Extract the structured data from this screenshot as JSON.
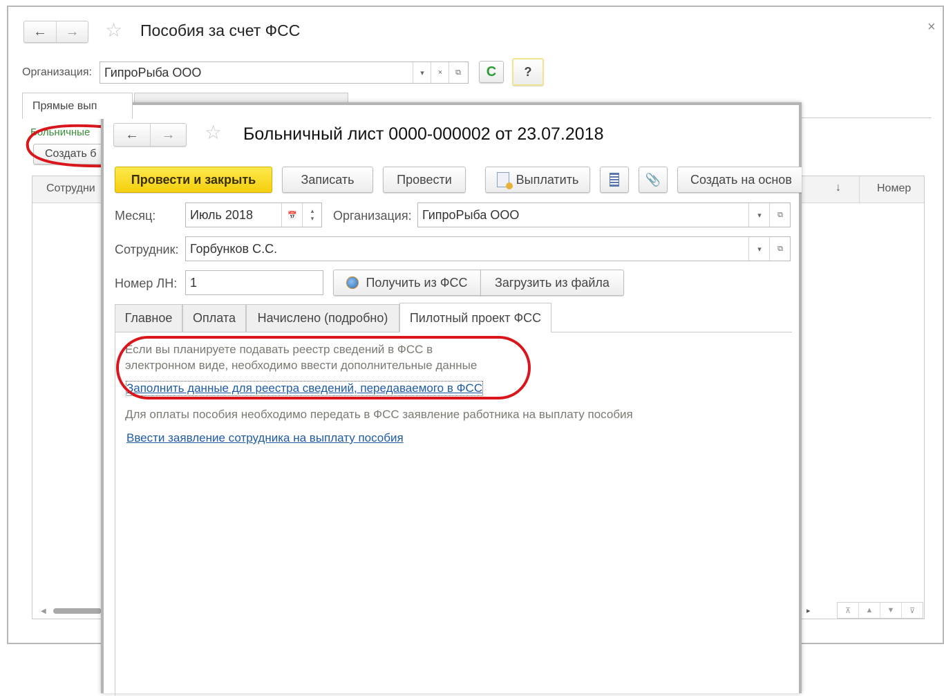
{
  "back_window": {
    "title": "Пособия за счет ФСС",
    "close_glyph": "×",
    "org_label": "Организация:",
    "org_value": "ГипроРыба ООО",
    "tab_direct_label": "Прямые вып",
    "section_link": "Больничные",
    "create_button": "Создать б",
    "col_employee": "Сотрудни",
    "col_sort_glyph": "↓",
    "col_number": "Номер",
    "help_button": "?",
    "refresh_glyph": "C"
  },
  "front_window": {
    "title": "Больничный лист 0000-000002 от 23.07.2018",
    "toolbar": {
      "post_close": "Провести и закрыть",
      "save": "Записать",
      "post": "Провести",
      "pay": "Выплатить",
      "create_based": "Создать на основ"
    },
    "month_label": "Месяц:",
    "month_value": "Июль 2018",
    "org_label": "Организация:",
    "org_value": "ГипроРыба ООО",
    "employee_label": "Сотрудник:",
    "employee_value": "Горбунков С.С.",
    "ln_label": "Номер ЛН:",
    "ln_value": "1",
    "get_from_fss": "Получить из ФСС",
    "load_from_file": "Загрузить из файла",
    "tabs": [
      "Главное",
      "Оплата",
      "Начислено (подробно)",
      "Пилотный проект ФСС"
    ],
    "hint_line1": "Если вы планируете подавать реестр сведений в ФСС в",
    "hint_line2": "электронном виде, необходимо ввести дополнительные данные",
    "link_fill_registry": "Заполнить данные для реестра сведений, передаваемого в ФСС",
    "hint_statement": "Для оплаты пособия необходимо передать в ФСС заявление работника на выплату пособия",
    "link_statement": "Ввести заявление сотрудника на выплату пособия"
  },
  "colors": {
    "highlight_ellipse": "#d9161c",
    "primary_button": "#f5cf0d",
    "link": "#1f5aa5",
    "refresh_icon": "#2e9b35"
  }
}
